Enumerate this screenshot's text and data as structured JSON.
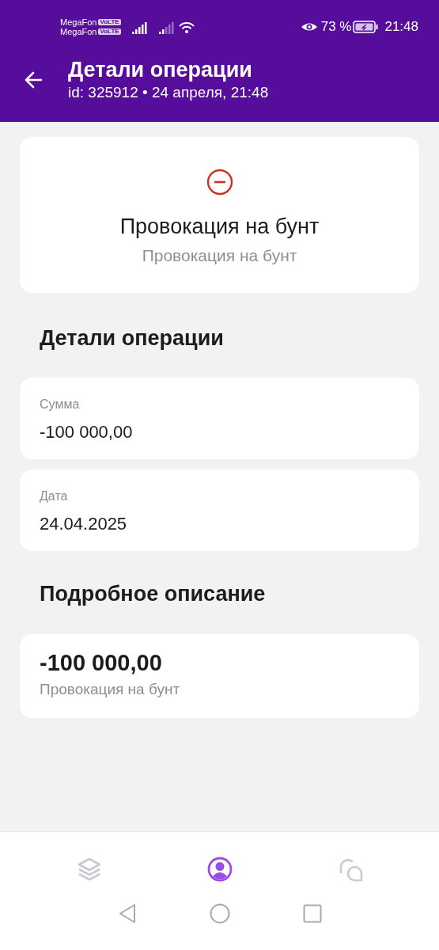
{
  "status_bar": {
    "carriers": [
      {
        "name": "MegaFon",
        "badge": "VoLTE"
      },
      {
        "name": "MegaFon",
        "badge": "VoLTE"
      }
    ],
    "battery_percent": "73 %",
    "time": "21:48"
  },
  "header": {
    "title": "Детали операции",
    "subtitle": "id: 325912 • 24 апреля, 21:48"
  },
  "summary": {
    "title": "Провокация на бунт",
    "subtitle": "Провокация на бунт"
  },
  "details": {
    "heading": "Детали операции",
    "fields": [
      {
        "label": "Сумма",
        "value": "-100 000,00"
      },
      {
        "label": "Дата",
        "value": "24.04.2025"
      }
    ]
  },
  "description": {
    "heading": "Подробное описание",
    "amount": "-100 000,00",
    "text": "Провокация на бунт"
  },
  "bottom_nav": [
    {
      "kind": "layers",
      "selected": false
    },
    {
      "kind": "profile",
      "selected": true
    },
    {
      "kind": "chat",
      "selected": false
    }
  ]
}
